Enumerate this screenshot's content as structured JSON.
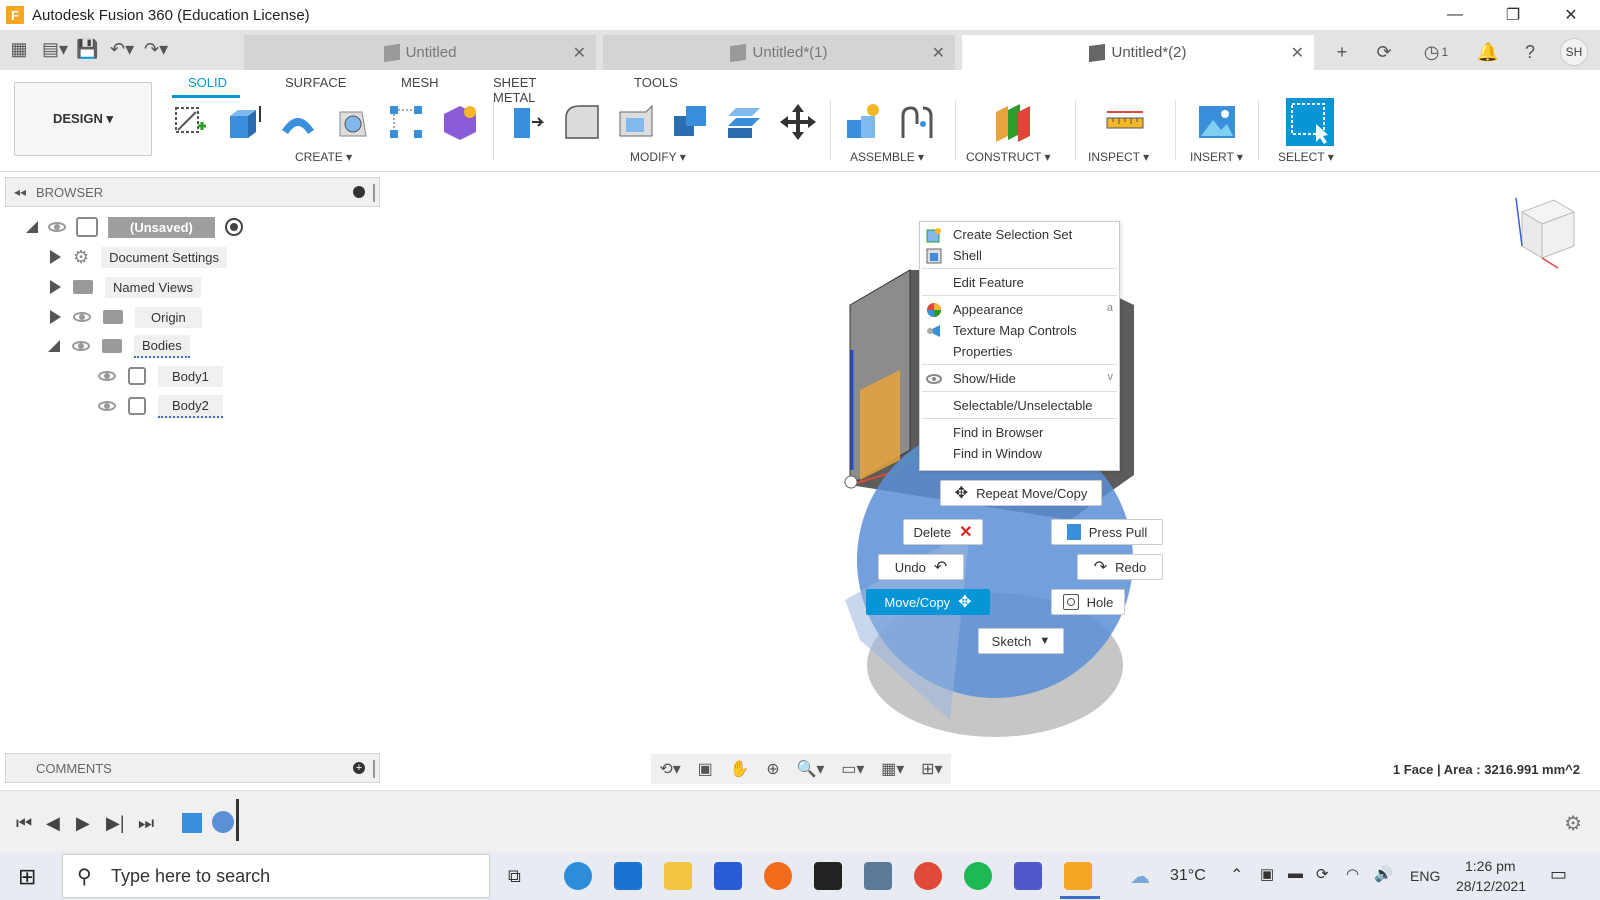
{
  "window": {
    "title": "Autodesk Fusion 360 (Education License)",
    "logo_letter": "F",
    "controls": [
      "—",
      "❐",
      "✕"
    ]
  },
  "doc_tabs": [
    {
      "label": "Untitled",
      "active": false
    },
    {
      "label": "Untitled*(1)",
      "active": false
    },
    {
      "label": "Untitled*(2)",
      "active": true
    }
  ],
  "header": {
    "job_count": "1",
    "user_initials": "SH"
  },
  "ribbon": {
    "tabs": [
      "SOLID",
      "SURFACE",
      "MESH",
      "SHEET METAL",
      "TOOLS"
    ],
    "workspace": "DESIGN ▾",
    "groups": [
      "CREATE ▾",
      "MODIFY ▾",
      "ASSEMBLE ▾",
      "CONSTRUCT ▾",
      "INSPECT ▾",
      "INSERT ▾",
      "SELECT ▾"
    ]
  },
  "browser": {
    "title": "BROWSER",
    "root": "(Unsaved)",
    "items": [
      "Document Settings",
      "Named Views",
      "Origin",
      "Bodies",
      "Body1",
      "Body2"
    ]
  },
  "context_menu": {
    "items": [
      {
        "label": "Create Selection Set",
        "shortcut": ""
      },
      {
        "label": "Shell",
        "shortcut": ""
      },
      {
        "label": "Edit Feature",
        "shortcut": ""
      },
      {
        "label": "Appearance",
        "shortcut": "a"
      },
      {
        "label": "Texture Map Controls",
        "shortcut": ""
      },
      {
        "label": "Properties",
        "shortcut": ""
      },
      {
        "label": "Show/Hide",
        "shortcut": "v"
      },
      {
        "label": "Selectable/Unselectable",
        "shortcut": ""
      },
      {
        "label": "Find in Browser",
        "shortcut": ""
      },
      {
        "label": "Find in Window",
        "shortcut": ""
      }
    ]
  },
  "marking_menu": {
    "repeat": "Repeat Move/Copy",
    "delete": "Delete",
    "press_pull": "Press Pull",
    "undo": "Undo",
    "redo": "Redo",
    "move_copy": "Move/Copy",
    "hole": "Hole",
    "sketch": "Sketch"
  },
  "comments": {
    "title": "COMMENTS"
  },
  "status": {
    "selection": "1 Face | Area : 3216.991 mm^2"
  },
  "taskbar": {
    "search_placeholder": "Type here to search",
    "temperature": "31°C",
    "language": "ENG",
    "time": "1:26 pm",
    "date": "28/12/2021"
  },
  "colors": {
    "accent": "#0696d7",
    "marking_sphere": "#5b8fd6",
    "body_orange": "#e8a33c"
  }
}
